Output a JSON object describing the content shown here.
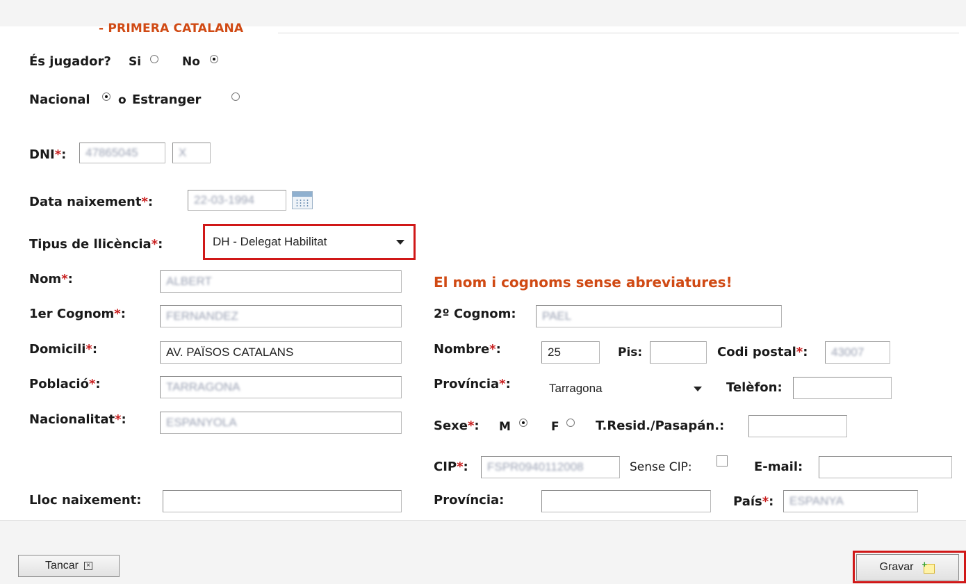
{
  "section_title": "- PRIMERA CATALANA",
  "jugador": {
    "label": "És jugador?",
    "si_label": "Si",
    "no_label": "No",
    "selected": "No"
  },
  "nacional": {
    "nacional_label": "Nacional",
    "o_label": "o",
    "estranger_label": "Estranger",
    "selected": "Nacional"
  },
  "dni": {
    "label": "DNI",
    "value": "47865045",
    "letter": "X"
  },
  "data_naixement": {
    "label": "Data naixement",
    "value": "22-03-1994"
  },
  "tipus_llicencia": {
    "label": "Tipus de llicència",
    "selected": "DH - Delegat Habilitat"
  },
  "warning": "El nom i cognoms sense abreviatures!",
  "nom": {
    "label": "Nom",
    "value": "ALBERT"
  },
  "cognom1": {
    "label": "1er Cognom",
    "value": "FERNANDEZ"
  },
  "cognom2": {
    "label": "2º Cognom:",
    "value": "PAEL"
  },
  "domicili": {
    "label": "Domicili",
    "value": "AV. PAÏSOS CATALANS"
  },
  "nombre": {
    "label": "Nombre",
    "value": "25"
  },
  "pis": {
    "label": "Pis:",
    "value": ""
  },
  "codi_postal": {
    "label": "Codi postal",
    "value": "43007"
  },
  "poblacio": {
    "label": "Població",
    "value": "TARRAGONA"
  },
  "provincia": {
    "label": "Província",
    "selected": "Tarragona"
  },
  "telefon": {
    "label": "Telèfon:",
    "value": ""
  },
  "nacionalitat": {
    "label": "Nacionalitat",
    "value": "ESPANYOLA"
  },
  "sexe": {
    "label": "Sexe",
    "m_label": "M",
    "f_label": "F",
    "selected": "M"
  },
  "tresid": {
    "label": "T.Resid./Pasapán.:",
    "value": ""
  },
  "cip": {
    "label": "CIP",
    "value": "FSPR0940112008"
  },
  "sense_cip": {
    "label": "Sense CIP:",
    "checked": false
  },
  "email": {
    "label": "E-mail:",
    "value": ""
  },
  "lloc_naixement": {
    "label": "Lloc naixement:",
    "value": ""
  },
  "provincia_naixement": {
    "label": "Província:",
    "value": ""
  },
  "pais": {
    "label": "País",
    "value": "ESPANYA"
  },
  "buttons": {
    "close_label": "Tancar",
    "save_label": "Gravar"
  },
  "colors": {
    "accent": "#d04a14",
    "required": "#c81e1e",
    "highlight": "#d01818"
  }
}
